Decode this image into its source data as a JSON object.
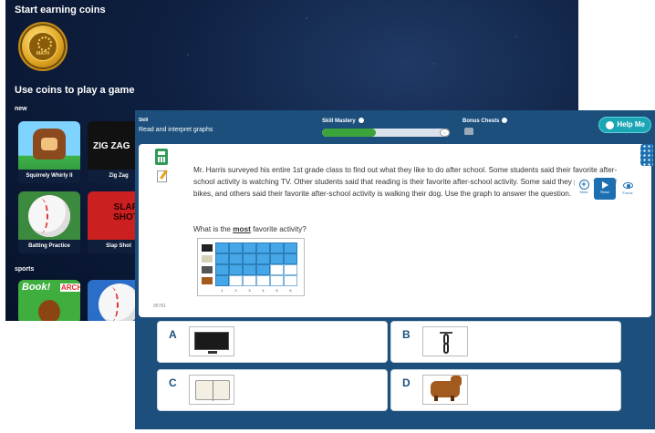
{
  "arcade": {
    "title": "Start earning coins",
    "coin_label": "MATH",
    "subtitle": "Use coins to play a game",
    "section_new": "new",
    "section_sports": "sports",
    "games": [
      {
        "name": "Squirrely Whirly II"
      },
      {
        "name": "Zig Zag",
        "art_text": "ZIG ZAG"
      },
      {
        "name": "Batting Practice"
      },
      {
        "name": "Slap Shot",
        "art_text": "SLAP SHOT"
      },
      {
        "name": "",
        "art_text": "Book!",
        "art_text2": "ARCH"
      },
      {
        "name": ""
      }
    ]
  },
  "practice": {
    "skill_heading": "Skill",
    "skill_name": "Read and interpret graphs",
    "mastery_heading": "Skill Mastery",
    "mastery_level": 0.42,
    "bonus_heading": "Bonus Chests",
    "help_label": "Help Me",
    "question_id": "95781",
    "question_text": "Mr. Harris surveyed his entire 1st grade class to find out what they like to do after school. Some students said their favorite after-school activity is watching TV. Other students said that reading is their favorite after-school activity. Some said they prefer riding their bikes, and others said their favorite after-school activity is walking their dog. Use the graph to answer the question.",
    "prompt_before": "What is the ",
    "prompt_bold": "most",
    "prompt_after": " favorite activity?",
    "tools": {
      "more": "More",
      "read": "Read",
      "focus": "Focus"
    },
    "graph": {
      "ticks": [
        "1",
        "2",
        "3",
        "4",
        "5",
        "6"
      ],
      "rows": [
        {
          "icon": "tv-icon",
          "value": 6
        },
        {
          "icon": "books-icon",
          "value": 6
        },
        {
          "icon": "bike-icon",
          "value": 4
        },
        {
          "icon": "dog-icon",
          "value": 1
        }
      ]
    },
    "answers": [
      {
        "letter": "A",
        "icon": "tv-icon"
      },
      {
        "letter": "B",
        "icon": "bike-icon"
      },
      {
        "letter": "C",
        "icon": "books-icon"
      },
      {
        "letter": "D",
        "icon": "dog-icon"
      }
    ]
  },
  "colors": {
    "panel_blue": "#1c4f7c",
    "mastery_green": "#3aa33a",
    "help_teal": "#1aa6b4",
    "graph_bar": "#46a7e8"
  }
}
